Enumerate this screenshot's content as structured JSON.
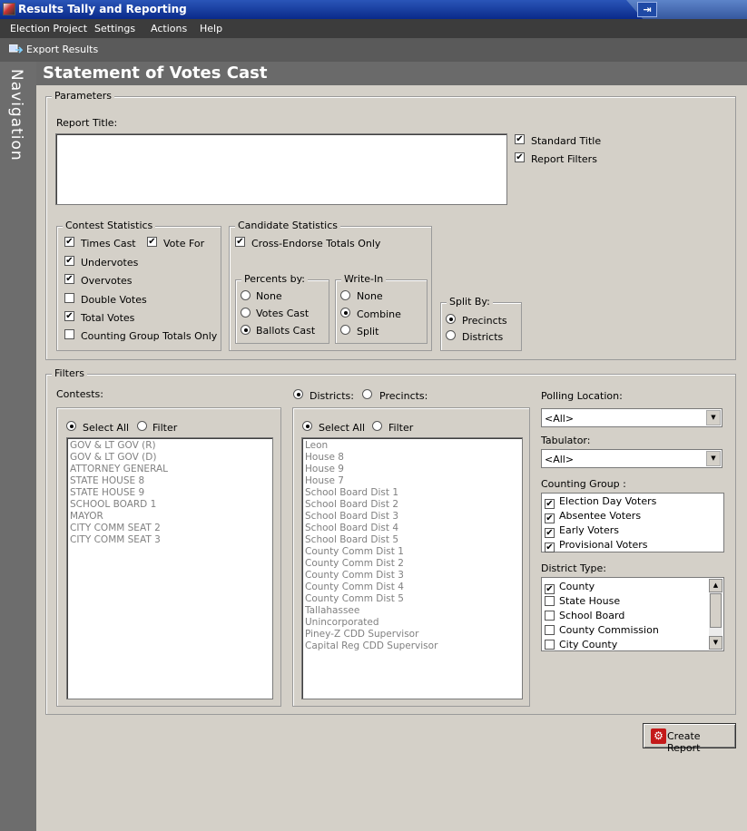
{
  "window": {
    "title": "Results Tally and Reporting",
    "pin_glyph": "⇥"
  },
  "menu": {
    "items": [
      "Election Project",
      "Settings",
      "Actions",
      "Help"
    ]
  },
  "toolbar": {
    "export_label": "Export Results"
  },
  "nav": {
    "label": "Navigation"
  },
  "page": {
    "title": "Statement of Votes Cast"
  },
  "parameters": {
    "legend": "Parameters",
    "report_title_label": "Report Title:",
    "report_title_value": "",
    "standard_title": {
      "label": "Standard Title",
      "checked": true
    },
    "report_filters": {
      "label": "Report Filters",
      "checked": true
    },
    "contest_statistics": {
      "legend": "Contest Statistics",
      "times_cast": {
        "label": "Times Cast",
        "checked": true
      },
      "vote_for": {
        "label": "Vote For",
        "checked": true
      },
      "undervotes": {
        "label": "Undervotes",
        "checked": true
      },
      "overvotes": {
        "label": "Overvotes",
        "checked": true
      },
      "double_votes": {
        "label": "Double Votes",
        "checked": false
      },
      "total_votes": {
        "label": "Total Votes",
        "checked": true
      },
      "counting_group_totals": {
        "label": "Counting Group Totals Only",
        "checked": false
      }
    },
    "candidate_statistics": {
      "legend": "Candidate Statistics",
      "cross_endorse": {
        "label": "Cross-Endorse Totals Only",
        "checked": true
      },
      "percents_by": {
        "legend": "Percents by:",
        "options": [
          "None",
          "Votes Cast",
          "Ballots Cast"
        ],
        "selected": "Ballots Cast"
      },
      "write_in": {
        "legend": "Write-In",
        "options": [
          "None",
          "Combine",
          "Split"
        ],
        "selected": "Combine"
      }
    },
    "split_by": {
      "legend": "Split By:",
      "options": [
        "Precincts",
        "Districts"
      ],
      "selected": "Precincts"
    }
  },
  "filters": {
    "legend": "Filters",
    "contests_label": "Contests:",
    "contests_mode": {
      "select_all": "Select All",
      "filter": "Filter",
      "selected": "Select All"
    },
    "contests": [
      "GOV & LT GOV (R)",
      "GOV & LT GOV (D)",
      "ATTORNEY GENERAL",
      "STATE HOUSE 8",
      "STATE HOUSE 9",
      "SCHOOL BOARD 1",
      "MAYOR",
      "CITY COMM SEAT 2",
      "CITY COMM SEAT 3"
    ],
    "scope": {
      "districts": "Districts:",
      "precincts": "Precincts:",
      "selected": "Districts:"
    },
    "districts_mode": {
      "select_all": "Select All",
      "filter": "Filter",
      "selected": "Select All"
    },
    "districts": [
      "Leon",
      "House 8",
      "House 9",
      "House 7",
      "School Board Dist 1",
      "School Board Dist 2",
      "School Board Dist 3",
      "School Board Dist 4",
      "School Board Dist 5",
      "County Comm Dist 1",
      "County Comm Dist 2",
      "County Comm Dist 3",
      "County Comm Dist 4",
      "County Comm Dist 5",
      "Tallahassee",
      "Unincorporated",
      "Piney-Z CDD Supervisor",
      "Capital Reg CDD Supervisor"
    ],
    "polling_location": {
      "label": "Polling Location:",
      "value": "<All>"
    },
    "tabulator": {
      "label": "Tabulator:",
      "value": "<All>"
    },
    "counting_group": {
      "label": "Counting Group :",
      "items": [
        {
          "label": "Election Day Voters",
          "checked": true
        },
        {
          "label": "Absentee Voters",
          "checked": true
        },
        {
          "label": "Early Voters",
          "checked": true
        },
        {
          "label": "Provisional Voters",
          "checked": true
        }
      ]
    },
    "district_type": {
      "label": "District Type:",
      "items": [
        {
          "label": "County",
          "checked": true
        },
        {
          "label": "State House",
          "checked": false
        },
        {
          "label": "School Board",
          "checked": false
        },
        {
          "label": "County Commission",
          "checked": false
        },
        {
          "label": "City County",
          "checked": false
        }
      ]
    }
  },
  "create_report": {
    "label": "Create Report",
    "icon": "gear-icon"
  },
  "icons": {
    "check": "✔",
    "down": "▼",
    "up": "▲"
  }
}
